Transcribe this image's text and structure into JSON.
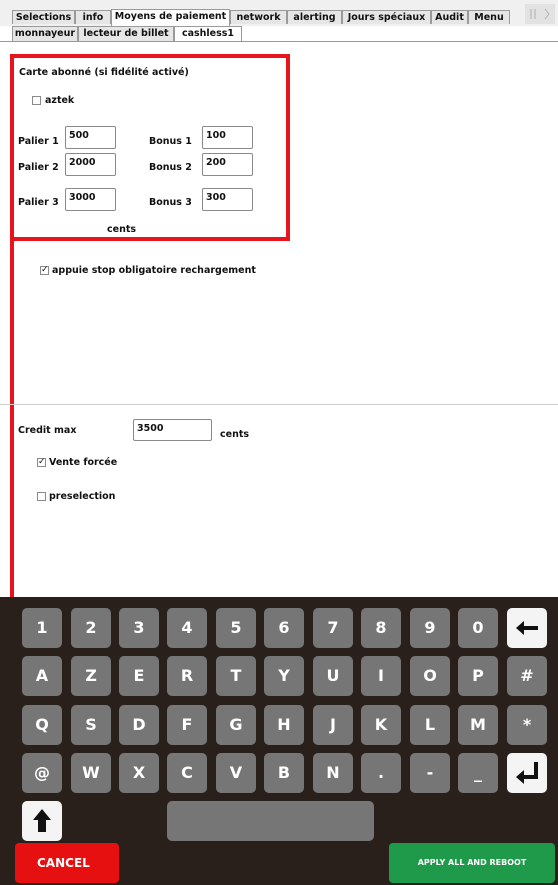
{
  "tabs": [
    "Selections",
    "info",
    "Moyens de paiement",
    "network",
    "alerting",
    "Jours spéciaux",
    "Audit",
    "Menu"
  ],
  "subtabs": [
    "monnayeur",
    "lecteur de billet",
    "cashless1"
  ],
  "loyalty": {
    "title": "Carte abonné (si fidélité activé)",
    "aztek_label": "aztek",
    "palier1_label": "Palier 1",
    "palier1_value": "500",
    "palier2_label": "Palier 2",
    "palier2_value": "2000",
    "palier3_label": "Palier 3",
    "palier3_value": "3000",
    "bonus1_label": "Bonus 1",
    "bonus1_value": "100",
    "bonus2_label": "Bonus 2",
    "bonus2_value": "200",
    "bonus3_label": "Bonus 3",
    "bonus3_value": "300",
    "unit": "cents"
  },
  "stop_label": "appuie stop obligatoire rechargement",
  "credit": {
    "label": "Credit max",
    "value": "3500",
    "unit": "cents",
    "vente_label": "Vente forcée",
    "preselection_label": "preselection"
  },
  "keyboard": {
    "row1": [
      "1",
      "2",
      "3",
      "4",
      "5",
      "6",
      "7",
      "8",
      "9",
      "0"
    ],
    "row2": [
      "A",
      "Z",
      "E",
      "R",
      "T",
      "Y",
      "U",
      "I",
      "O",
      "P",
      "#"
    ],
    "row3": [
      "Q",
      "S",
      "D",
      "F",
      "G",
      "H",
      "J",
      "K",
      "L",
      "M",
      "*"
    ],
    "row4": [
      "@",
      "W",
      "X",
      "C",
      "V",
      "B",
      "N",
      ".",
      "-",
      "_"
    ]
  },
  "buttons": {
    "cancel": "CANCEL",
    "apply": "APPLY ALL AND REBOOT"
  }
}
